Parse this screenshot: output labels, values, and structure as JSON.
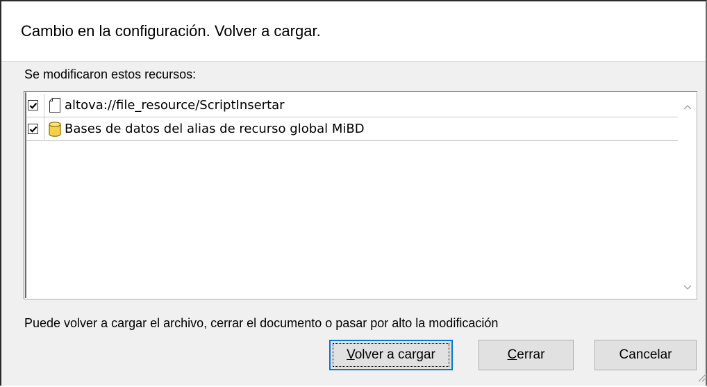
{
  "dialog": {
    "title": "Cambio en la configuración. Volver a cargar.",
    "resources_label": "Se modificaron estos recursos:",
    "resources": [
      {
        "checked": true,
        "icon": "file-icon",
        "label": "altova://file_resource/ScriptInsertar"
      },
      {
        "checked": true,
        "icon": "database-icon",
        "label": "Bases de datos del alias de recurso global MiBD"
      }
    ],
    "footer_text": "Puede volver a cargar el archivo, cerrar el documento o pasar por alto la modificación",
    "buttons": {
      "reload_mnemonic": "V",
      "reload_rest": "olver a cargar",
      "close_mnemonic": "C",
      "close_rest": "errar",
      "cancel": "Cancelar"
    }
  },
  "colors": {
    "dialog_bg": "#f0f0f0",
    "header_bg": "#ffffff",
    "default_button_border": "#0078d7",
    "db_icon_fill": "#f7d04a"
  }
}
